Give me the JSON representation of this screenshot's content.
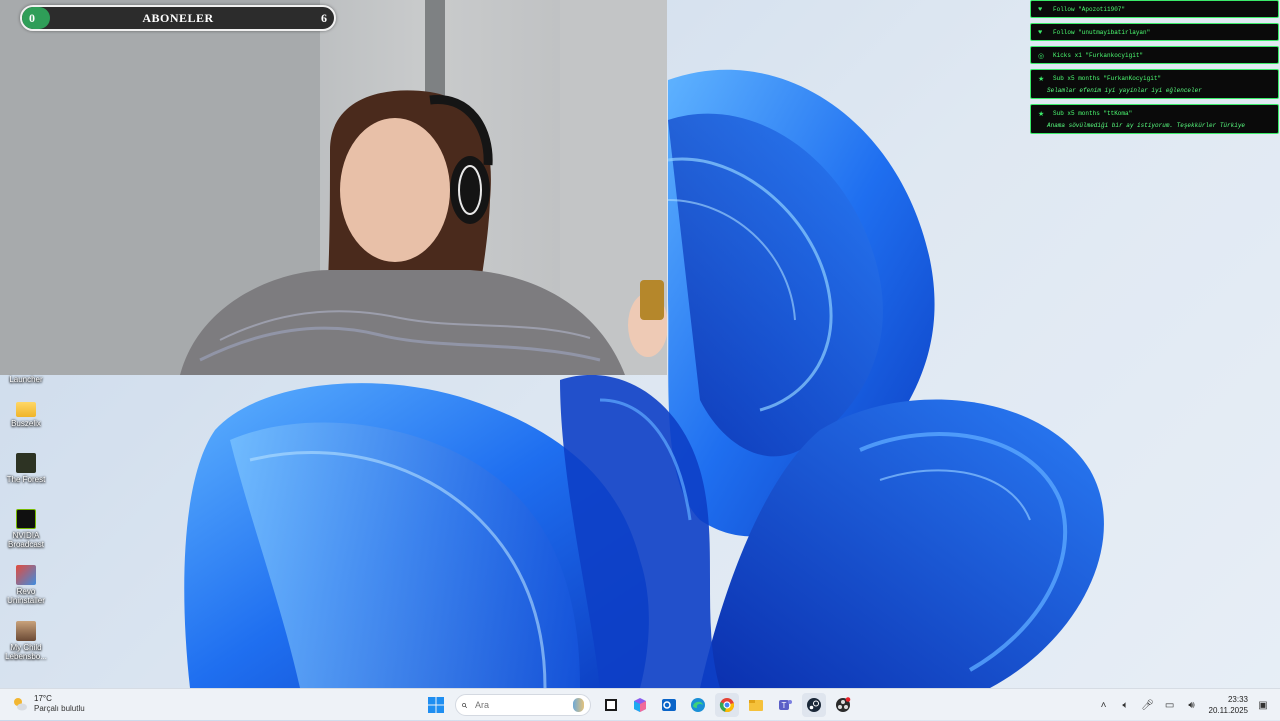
{
  "goal": {
    "label": "ABONELER",
    "current": "0",
    "target": "6",
    "progress_fraction": 0
  },
  "events": [
    {
      "icon": "heart-icon",
      "text": "Follow \"Apozoti1907\"",
      "message": ""
    },
    {
      "icon": "heart-icon",
      "text": "Follow \"unutmayibatirlayan\"",
      "message": ""
    },
    {
      "icon": "kick-icon",
      "text": "Kicks x1 \"Furkankocyigit\"",
      "message": ""
    },
    {
      "icon": "star-icon",
      "text": "Sub x5 months \"FurkanKocyigit\"",
      "message": "Selamlar efenim iyi yayinlar iyi eğlenceler"
    },
    {
      "icon": "star-icon",
      "text": "Sub x5 months \"ttKoma\"",
      "message": "Anama sövülmediği bir ay istiyorum. Teşekkürler Türkiye"
    }
  ],
  "desktop_icons": [
    {
      "label": "Launcher",
      "icon": "launcher-icon"
    },
    {
      "label": "Buszelix",
      "icon": "folder-icon"
    },
    {
      "label": "The Forest",
      "icon": "the-forest-icon"
    },
    {
      "label": "NVIDIA Broadcast",
      "icon": "nvidia-icon"
    },
    {
      "label": "Revo Uninstaller",
      "icon": "revo-icon"
    },
    {
      "label": "My Child Lebensbo...",
      "icon": "my-child-lebensborn-icon"
    }
  ],
  "taskbar": {
    "weather_temp": "17°C",
    "weather_desc": "Parçalı bulutlu",
    "search_placeholder": "Ara",
    "apps": [
      "windows-start-icon",
      "task-view-icon",
      "copilot-icon",
      "outlook-icon",
      "edge-icon",
      "chrome-icon",
      "file-explorer-icon",
      "teams-icon",
      "steam-icon",
      "obs-icon"
    ],
    "clock_time": "23:33",
    "clock_date": "20.11.2025"
  },
  "colors": {
    "goal_fill": "#2f9e58",
    "feed_accent": "#4dff73",
    "wallpaper_blue": "#1a63e0"
  }
}
